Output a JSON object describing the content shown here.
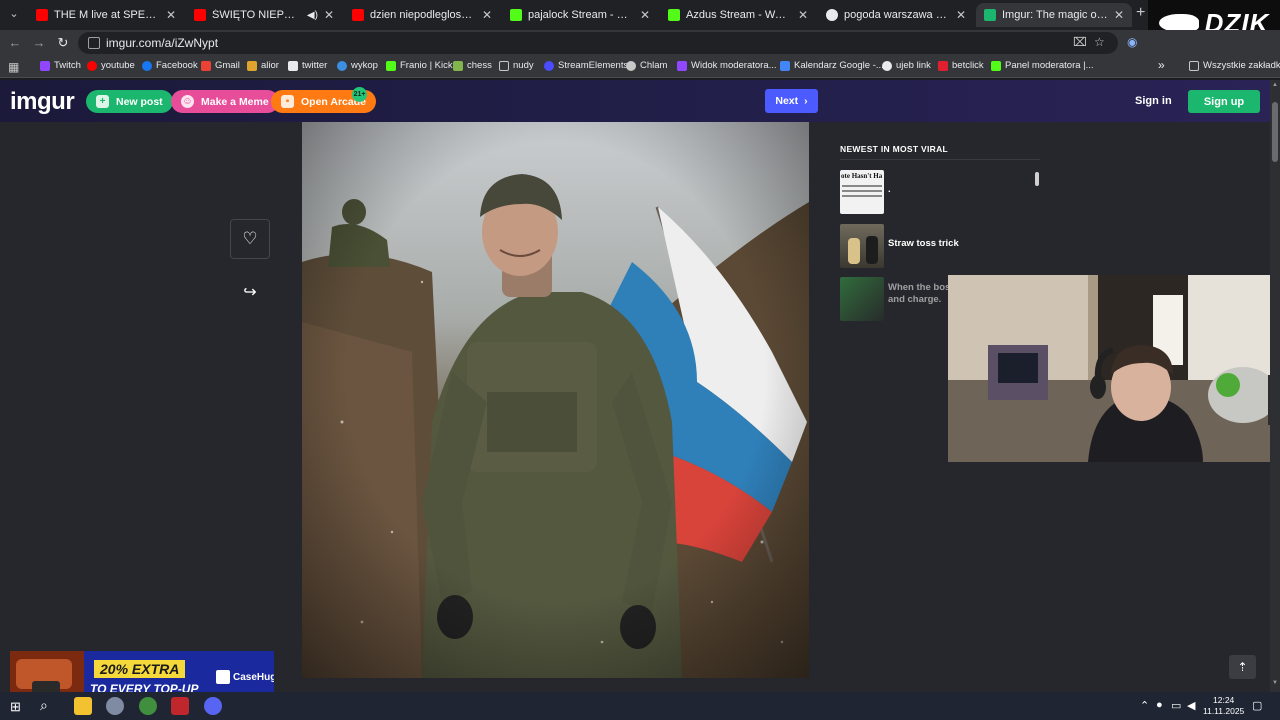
{
  "browser": {
    "tabs": [
      {
        "label": "THE M live at SPEEDLAND FEST",
        "icon": "youtube-icon",
        "color": "#ff0000"
      },
      {
        "label": "ŚWIĘTO NIEPODLEGŁOŚCI",
        "icon": "youtube-icon",
        "color": "#ff0000"
      },
      {
        "label": "dzien niepodleglosci - YouTube",
        "icon": "youtube-icon",
        "color": "#ff0000"
      },
      {
        "label": "pajalock Stream - Watch Live o",
        "icon": "kick-icon",
        "color": "#53fc18"
      },
      {
        "label": "Azdus Stream - Watch Live on",
        "icon": "kick-icon",
        "color": "#53fc18"
      },
      {
        "label": "pogoda warszawa - Szukaj w G",
        "icon": "google-icon",
        "color": "#e8eaed"
      },
      {
        "label": "Imgur: The magic of the Interne",
        "icon": "imgur-icon",
        "color": "#1bb76e"
      }
    ],
    "url": "imgur.com/a/iZwNypt",
    "bookmarks": [
      {
        "label": "Twitch",
        "color": "#9146ff"
      },
      {
        "label": "youtube",
        "color": "#ff0000"
      },
      {
        "label": "Facebook",
        "color": "#1877f2"
      },
      {
        "label": "Gmail",
        "color": "#ea4335"
      },
      {
        "label": "alior",
        "color": "#e0a32e"
      },
      {
        "label": "twitter",
        "color": "#e8eaed"
      },
      {
        "label": "wykop",
        "color": "#3b8ee0"
      },
      {
        "label": "Franio | Kick",
        "color": "#53fc18"
      },
      {
        "label": "chess",
        "color": "#81b64c"
      },
      {
        "label": "nudy",
        "color": "#c8c8c8"
      },
      {
        "label": "StreamElements",
        "color": "#4b4bff"
      },
      {
        "label": "Chlam",
        "color": "#c8c8c8"
      },
      {
        "label": "Widok moderatora...",
        "color": "#9146ff"
      },
      {
        "label": "Kalendarz Google -...",
        "color": "#4285f4"
      },
      {
        "label": "ujeb link",
        "color": "#e8eaed"
      },
      {
        "label": "betclick",
        "color": "#e0202e"
      },
      {
        "label": "Panel moderatora |...",
        "color": "#53fc18"
      }
    ],
    "bookmarks_more": "»",
    "all_bookmarks": "Wszystkie zakładki"
  },
  "overlay": {
    "brand": "DZIK"
  },
  "imgur": {
    "logo": "imgur",
    "new_post": "New post",
    "make_meme": "Make a Meme",
    "open_arcade": "Open Arcade",
    "arcade_badge": "21+",
    "next": "Next",
    "sign_in": "Sign in",
    "sign_up": "Sign up",
    "sidebar": {
      "title": "NEWEST IN MOST VIRAL",
      "items": [
        {
          "label": ".",
          "thumb_text": "ote Hasn't Ha"
        },
        {
          "label": "Straw toss trick"
        },
        {
          "label": "When the boss something and charge."
        }
      ]
    }
  },
  "ad": {
    "line1": "20% EXTRA",
    "line2": "TO EVERY TOP-UP",
    "brand": "CaseHug"
  },
  "taskbar": {
    "time": "12:24",
    "date": "11.11.2025"
  }
}
